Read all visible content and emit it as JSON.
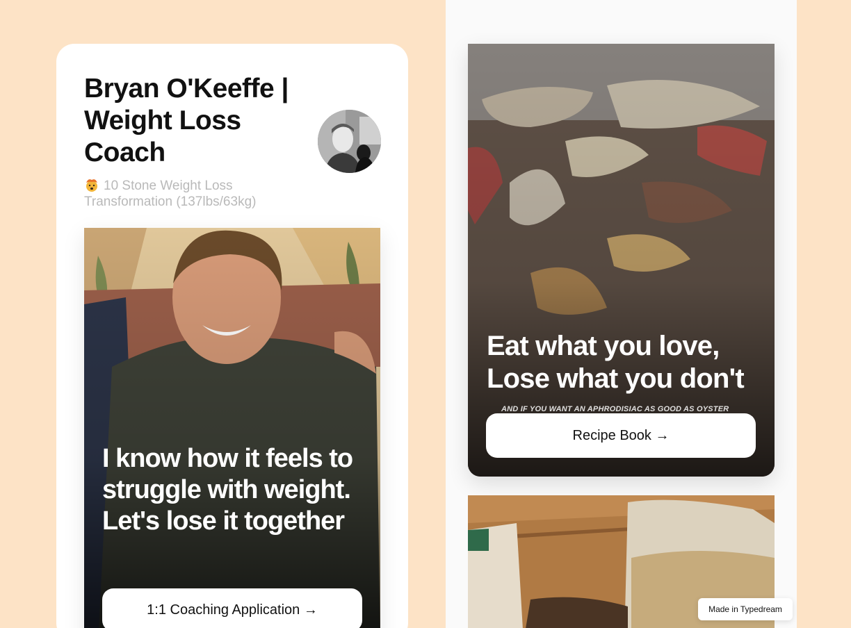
{
  "profile": {
    "name": "Bryan O'Keeffe | Weight Loss Coach",
    "subtitle_emoji": "exploding-head-emoji",
    "subtitle": "10 Stone Weight Loss Transformation (137lbs/63kg)"
  },
  "hero": {
    "heading": "I know how it feels to struggle with weight. Let's lose it together",
    "button_label": "1:1 Coaching Application →"
  },
  "recipe": {
    "heading": "Eat what you love, Lose what you don't",
    "caption": "AND IF YOU WANT AN APHRODISIAC AS GOOD AS OYSTER",
    "button_label": "Recipe Book →"
  },
  "badge": {
    "label": "Made in Typedream"
  },
  "colors": {
    "background": "#fde3c6",
    "card": "#ffffff",
    "panel": "#fafafa",
    "subtitle_text": "#b9b9b9"
  }
}
